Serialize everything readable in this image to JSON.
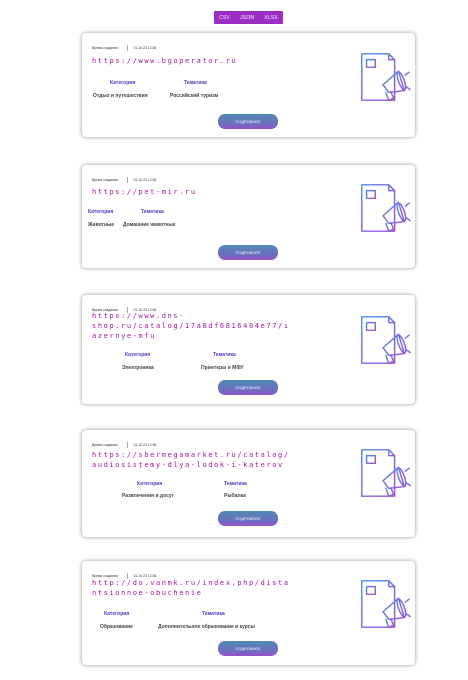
{
  "export": {
    "csv": "CSV",
    "json": "JSON",
    "xlsx": "XLSX"
  },
  "labels": {
    "created": "Время создания",
    "category": "Категория",
    "topic": "Тематика",
    "more": "ПОДРОБНЕЕ"
  },
  "icon": "document-megaphone-icon",
  "colors": {
    "accent": "#9b2cc4",
    "url": "#a1189b",
    "label": "#4b3cc4"
  },
  "cards": [
    {
      "date": "01.10.23 12:38",
      "url": "https://www.bgoperator.ru",
      "category": "Отдых и путешествия",
      "topic": "Российский туризм"
    },
    {
      "date": "01.10.23 12:38",
      "url": "https://pet-mir.ru",
      "category": "Животные",
      "topic": "Домашние животные"
    },
    {
      "date": "01.10.23 12:38",
      "url_lines": [
        "https://www.dns-",
        "shop.ru/catalog/17a8df6816404e77/i",
        "azernye-mfu"
      ],
      "category": "Электроника",
      "topic": "Принтеры и МФУ"
    },
    {
      "date": "01.10.23 12:38",
      "url_lines": [
        "https://sbermegamarket.ru/catalog/",
        "audiosistemy-dlya-lodok-i-katerov"
      ],
      "category": "Развлечения и досуг",
      "topic": "Рыбалка"
    },
    {
      "date": "01.10.23 12:38",
      "url_lines": [
        "http://do.vanmk.ru/index.php/dista",
        "ntsionnoe-obuchenie"
      ],
      "category": "Образование",
      "topic": "Дополнительное образование и курсы"
    }
  ]
}
